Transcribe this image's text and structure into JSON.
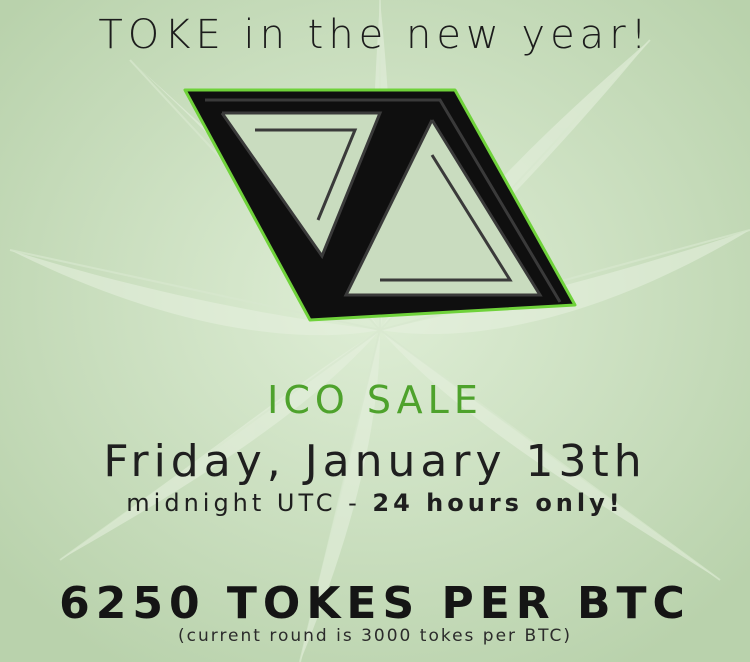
{
  "headline": "TOKE in the new year!",
  "logo": {
    "icon": "impossible-triangle-logo",
    "outline_color": "#6fd23a",
    "fill_color": "#111111"
  },
  "sale": {
    "title": "ICO SALE",
    "title_color": "#4ea22c",
    "date": "Friday, January 13th",
    "time_prefix": "midnight UTC - ",
    "time_emphasis": "24 hours only!"
  },
  "rate": {
    "headline": "6250 TOKES PER BTC",
    "note": "(current round is 3000 tokes per BTC)"
  },
  "background": {
    "icon": "cannabis-leaf-pattern",
    "color": "#c9dcbf"
  }
}
